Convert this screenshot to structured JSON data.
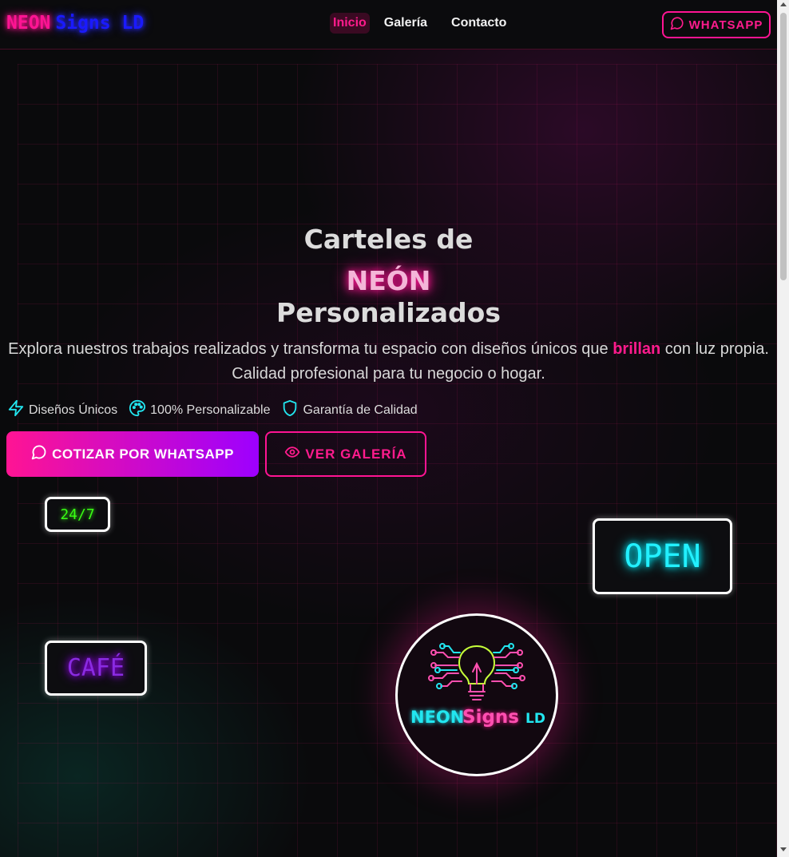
{
  "header": {
    "logo_neon": "NEON",
    "logo_signs": "Signs LD",
    "nav": [
      {
        "label": "Inicio",
        "active": true
      },
      {
        "label": "Galería",
        "active": false
      },
      {
        "label": "Contacto",
        "active": false
      }
    ],
    "whatsapp_label": "WHATSAPP"
  },
  "hero": {
    "title_line1": "Carteles de",
    "title_line2": "NEÓN",
    "title_line3": "Personalizados",
    "subtitle_before": "Explora nuestros trabajos realizados y transforma tu espacio con diseños únicos que ",
    "subtitle_highlight": "brillan",
    "subtitle_after": " con luz propia. Calidad profesional para tu negocio o hogar.",
    "features": [
      {
        "icon": "lightning-icon",
        "label": "Diseños Únicos"
      },
      {
        "icon": "palette-icon",
        "label": "100% Personalizable"
      },
      {
        "icon": "shield-icon",
        "label": "Garantía de Calidad"
      }
    ],
    "cta_primary": "COTIZAR POR WHATSAPP",
    "cta_secondary": "VER GALERÍA"
  },
  "signs": {
    "sign_247": "24/7",
    "sign_cafe": "CAFÉ",
    "sign_open": "OPEN",
    "badge_neon": "NEON",
    "badge_signs": "Signs",
    "badge_ld": "LD"
  },
  "colors": {
    "accent_pink": "#ff1493",
    "accent_purple": "#9d00ff",
    "neon_green": "#39ff14",
    "neon_cyan": "#00f0ff",
    "logo_blue": "#1a1aff",
    "background": "#0b0b0d"
  }
}
